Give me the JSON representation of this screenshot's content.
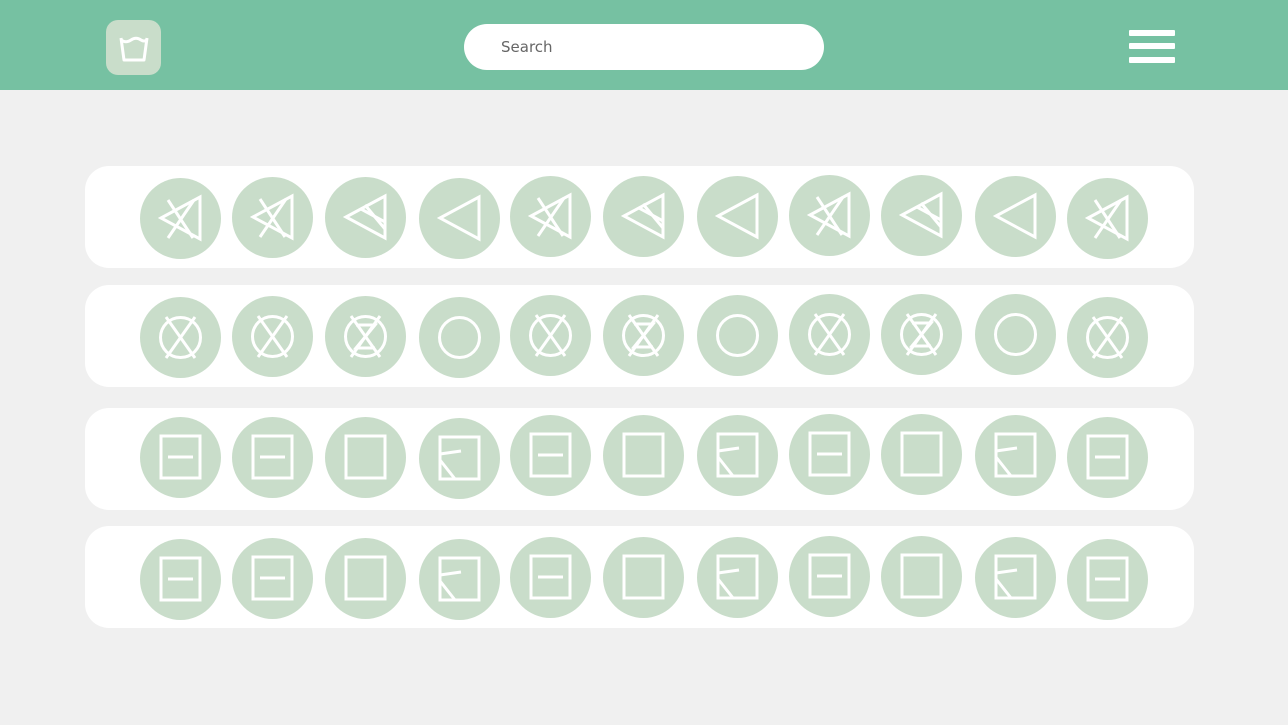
{
  "header": {
    "logo_icon": "washtub-icon",
    "search": {
      "placeholder": "Search",
      "value": ""
    },
    "menu_icon": "hamburger-menu-icon"
  },
  "colors": {
    "header_bg": "#76c1a2",
    "page_bg": "#f0f0f0",
    "row_bg": "#ffffff",
    "symbol_bg": "#c9ddca",
    "symbol_stroke": "#ffffff"
  },
  "symbol_rows": [
    {
      "name": "bleach-row",
      "icons": [
        "bleach-crossed-icon",
        "bleach-crossed-icon",
        "bleach-non-chlorine-icon",
        "bleach-any-icon",
        "bleach-crossed-icon",
        "bleach-non-chlorine-icon",
        "bleach-any-icon",
        "bleach-crossed-icon",
        "bleach-non-chlorine-icon",
        "bleach-any-icon",
        "bleach-crossed-icon"
      ]
    },
    {
      "name": "dry-clean-row",
      "icons": [
        "dry-clean-crossed-icon",
        "dry-clean-crossed-icon",
        "wet-clean-crossed-icon",
        "dry-clean-icon",
        "dry-clean-crossed-icon",
        "wet-clean-crossed-icon",
        "dry-clean-icon",
        "dry-clean-crossed-icon",
        "wet-clean-crossed-icon",
        "dry-clean-icon",
        "dry-clean-crossed-icon"
      ]
    },
    {
      "name": "dry-row-1",
      "icons": [
        "dry-flat-icon",
        "dry-flat-icon",
        "natural-dry-icon",
        "dry-flat-in-shade-icon",
        "dry-flat-icon",
        "natural-dry-icon",
        "dry-flat-in-shade-icon",
        "dry-flat-icon",
        "natural-dry-icon",
        "dry-flat-in-shade-icon",
        "dry-flat-icon"
      ]
    },
    {
      "name": "dry-row-2",
      "icons": [
        "dry-flat-icon",
        "dry-flat-icon",
        "natural-dry-icon",
        "dry-flat-in-shade-icon",
        "dry-flat-icon",
        "natural-dry-icon",
        "dry-flat-in-shade-icon",
        "dry-flat-icon",
        "natural-dry-icon",
        "dry-flat-in-shade-icon",
        "dry-flat-icon"
      ]
    }
  ]
}
